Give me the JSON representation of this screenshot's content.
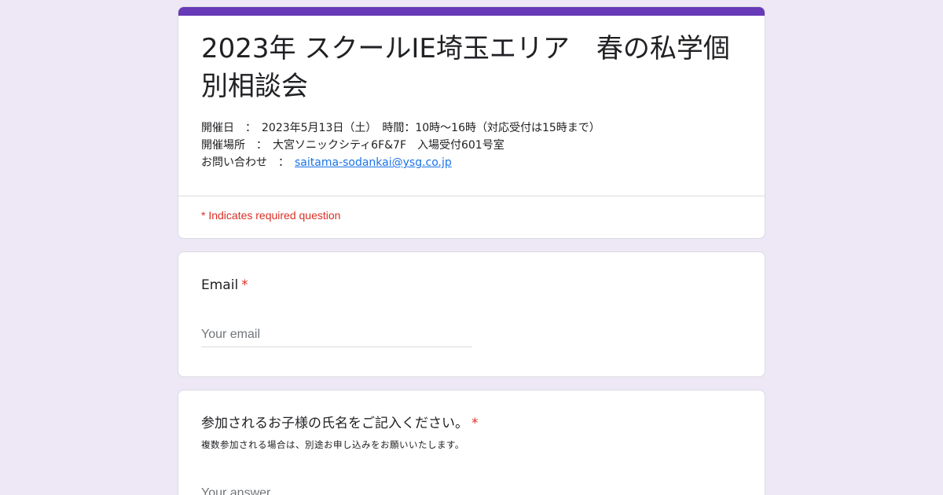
{
  "form": {
    "title": "2023年 スクールIE埼玉エリア　春の私学個別相談会",
    "accent_color": "#673ab7",
    "description": {
      "line1": "開催日　：　2023年5月13日（土）　時間：10時～16時（対応受付は15時まで）",
      "line2": "開催場所　：　大宮ソニックシティ6F&7F　入場受付601号室",
      "line3_prefix": "お問い合わせ　：　",
      "contact_email": "saitama-sodankai@ysg.co.jp"
    },
    "required_note": "* Indicates required question"
  },
  "questions": {
    "email": {
      "label": "Email",
      "required_mark": "*",
      "placeholder": "Your email"
    },
    "child_name": {
      "label": "参加されるお子様の氏名をご記入ください。",
      "required_mark": "*",
      "help_text": "複数参加される場合は、別途お申し込みをお願いいたします。",
      "placeholder": "Your answer"
    }
  }
}
